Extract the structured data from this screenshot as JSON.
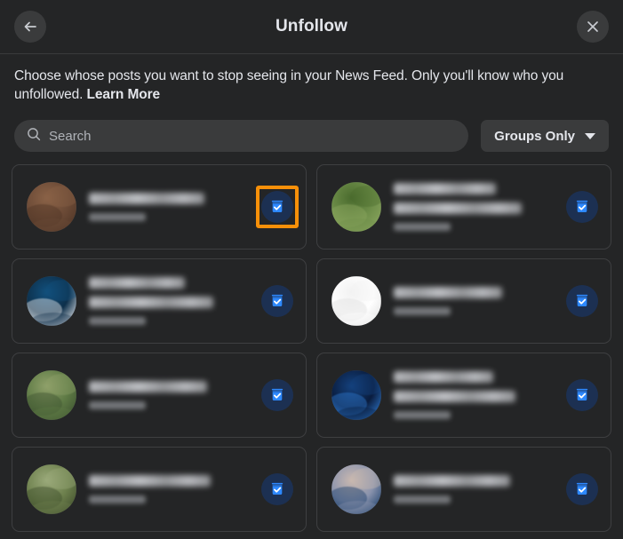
{
  "header": {
    "title": "Unfollow",
    "back_icon": "arrow-left-icon",
    "close_icon": "close-icon"
  },
  "description": {
    "text": "Choose whose posts you want to stop seeing in your News Feed. Only you'll know who you unfollowed. ",
    "link_label": "Learn More"
  },
  "controls": {
    "search": {
      "placeholder": "Search",
      "value": "",
      "icon": "search-icon"
    },
    "filter": {
      "label": "Groups Only",
      "icon": "chevron-down-icon"
    }
  },
  "colors": {
    "page_background": "#242526",
    "card_background": "#242526",
    "card_border": "#3e3f41",
    "control_background": "#3a3b3c",
    "text_primary": "#e4e6eb",
    "text_secondary": "#b0b3b8",
    "checkbox_blue": "#2d88ff",
    "checkbox_circle": "#1c3052",
    "highlight_orange": "#f79009"
  },
  "list": {
    "items": [
      {
        "name_redacted": true,
        "name_lines": 1,
        "status": "Following",
        "checked": true,
        "highlighted": true,
        "avatar": {
          "alt": "shooters-club-photo",
          "colors": [
            "#6b4a36",
            "#8a6247",
            "#4f3526"
          ]
        }
      },
      {
        "name_redacted": true,
        "name_lines": 2,
        "status": "Following",
        "checked": true,
        "highlighted": false,
        "avatar": {
          "alt": "bowhunters-photo",
          "colors": [
            "#6f8f4a",
            "#4a6b2e",
            "#8ba65f"
          ]
        }
      },
      {
        "name_redacted": true,
        "name_lines": 2,
        "status": "Following",
        "checked": true,
        "highlighted": false,
        "avatar": {
          "alt": "investors-photo",
          "colors": [
            "#0d2f4a",
            "#12507d",
            "#e8eaed"
          ]
        }
      },
      {
        "name_redacted": true,
        "name_lines": 1,
        "status": "Following",
        "checked": true,
        "highlighted": false,
        "avatar": {
          "alt": "crypto-den-logo",
          "colors": [
            "#ffffff",
            "#f2f2f2",
            "#e0e0e0"
          ]
        }
      },
      {
        "name_redacted": true,
        "name_lines": 1,
        "status": "Following",
        "checked": true,
        "highlighted": false,
        "avatar": {
          "alt": "creek-fishing-photo",
          "colors": [
            "#5e7a45",
            "#8fa06a",
            "#3d5230"
          ]
        }
      },
      {
        "name_redacted": true,
        "name_lines": 2,
        "status": "Following",
        "checked": true,
        "highlighted": false,
        "avatar": {
          "alt": "fundamental-analysis-photo",
          "colors": [
            "#0a1c3d",
            "#14417d",
            "#2f7ad1"
          ]
        }
      },
      {
        "name_redacted": true,
        "name_lines": 1,
        "status": "Following",
        "checked": true,
        "highlighted": false,
        "avatar": {
          "alt": "rock-anglers-photo",
          "colors": [
            "#6c7f4c",
            "#9aa97a",
            "#3f4d2c"
          ]
        }
      },
      {
        "name_redacted": true,
        "name_lines": 1,
        "status": "Following",
        "checked": true,
        "highlighted": false,
        "avatar": {
          "alt": "crypto-cafe-logo",
          "colors": [
            "#8a93ad",
            "#c9b8b0",
            "#1a3f6b"
          ]
        }
      }
    ]
  }
}
